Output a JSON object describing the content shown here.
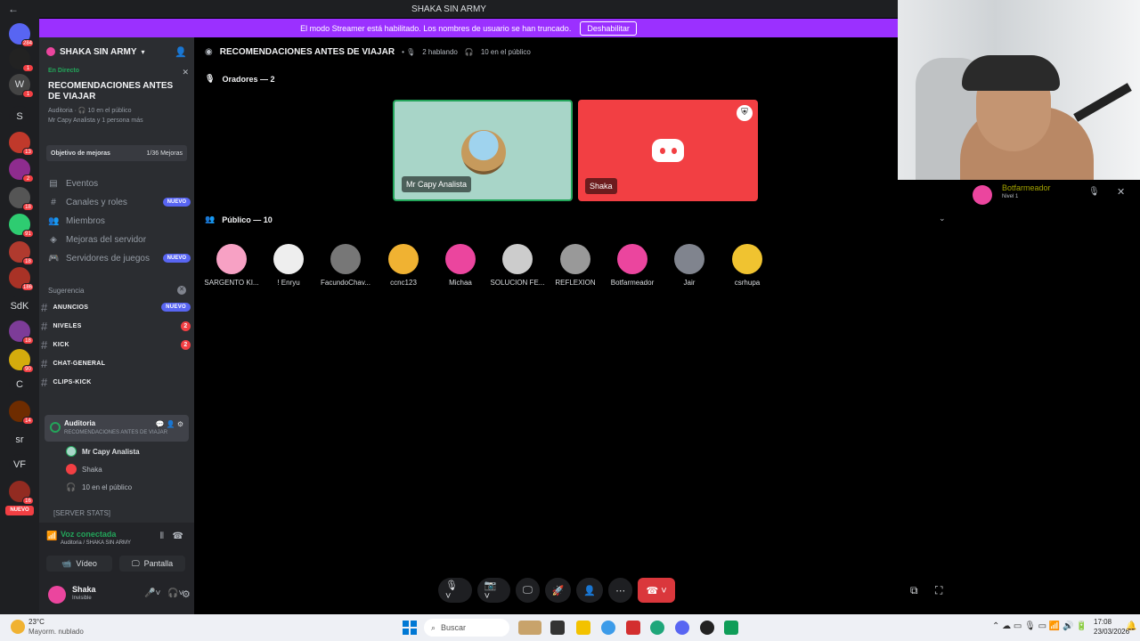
{
  "window": {
    "title": "SHAKA SIN ARMY",
    "back": "←"
  },
  "banner": {
    "text": "El modo Streamer está habilitado. Los nombres de usuario se han truncado.",
    "button": "Deshabilitar"
  },
  "rail": {
    "servers": [
      {
        "label": "",
        "badge": "284",
        "color": "#5865f2"
      },
      {
        "label": "",
        "badge": "1",
        "color": "#222"
      },
      {
        "label": "W",
        "badge": "1",
        "color": "#444"
      },
      {
        "label": "S",
        "badge": "",
        "color": "#1e1f22"
      },
      {
        "label": "",
        "badge": "13",
        "color": "#c0392b"
      },
      {
        "label": "",
        "badge": "2",
        "color": "#8e2c8e"
      },
      {
        "label": "",
        "badge": "18",
        "color": "#555"
      },
      {
        "label": "",
        "badge": "91",
        "color": "#2ecc71"
      },
      {
        "label": "",
        "badge": "18",
        "color": "#b03a2e"
      },
      {
        "label": "",
        "badge": "186",
        "color": "#a93226"
      },
      {
        "label": "SdK",
        "badge": "",
        "color": "#1e1f22"
      },
      {
        "label": "",
        "badge": "18",
        "color": "#7d3c98"
      },
      {
        "label": "",
        "badge": "90",
        "color": "#d4ac0d"
      },
      {
        "label": "C",
        "badge": "",
        "color": "#1e1f22"
      },
      {
        "label": "",
        "badge": "14",
        "color": "#6e2c00"
      },
      {
        "label": "sr",
        "badge": "",
        "color": "#1e1f22"
      },
      {
        "label": "VF",
        "badge": "",
        "color": "#1e1f22"
      },
      {
        "label": "",
        "badge": "16",
        "color": "#922b21"
      }
    ],
    "nuevo": "NUEVO"
  },
  "sidebar": {
    "server_name": "SHAKA SIN ARMY",
    "live": {
      "tag": "En Directo",
      "title": "RECOMENDACIONES ANTES DE VIAJAR",
      "meta1": "Auditoria · 🎧 10 en el público",
      "meta2": "Mr Capy Analista y 1 persona más"
    },
    "goal": {
      "label": "Objetivo de mejoras",
      "value": "1/36 Mejoras"
    },
    "nav": [
      {
        "icon": "▤",
        "label": "Eventos",
        "badge": ""
      },
      {
        "icon": "#",
        "label": "Canales y roles",
        "badge": "NUEVO"
      },
      {
        "icon": "👥",
        "label": "Miembros",
        "badge": ""
      },
      {
        "icon": "◈",
        "label": "Mejoras del servidor",
        "badge": ""
      },
      {
        "icon": "🎮",
        "label": "Servidores de juegos",
        "badge": "NUEVO"
      }
    ],
    "suggestion": "Sugerencia",
    "channels": [
      {
        "name": "ANUNCIOS",
        "badge": "NUEVO"
      },
      {
        "name": "NIVELES",
        "badge": "2"
      },
      {
        "name": "KICK",
        "badge": "2"
      },
      {
        "name": "CHAT-GENERAL",
        "badge": ""
      },
      {
        "name": "CLIPS-KICK",
        "badge": ""
      }
    ],
    "stage": {
      "name": "Auditoria",
      "topic": "RECOMENDACIONES ANTES DE VIAJAR"
    },
    "stage_members": [
      "Mr Capy Analista",
      "Shaka",
      "10 en el público"
    ],
    "server_stats": "[SERVER STATS]",
    "voice": {
      "status": "Voz conectada",
      "where": "Auditoria / SHAKA SIN ARMY",
      "video": "Vídeo",
      "screen": "Pantalla"
    },
    "user": {
      "name": "Shaka",
      "status": "Invisible"
    }
  },
  "main": {
    "channel": "RECOMENDACIONES ANTES DE VIAJAR",
    "speaking": "2 hablando",
    "audience_count": "10 en el público",
    "speakers_header": "Oradores — 2",
    "audience_header": "Público — 10",
    "speakers": [
      {
        "name": "Mr Capy Analista",
        "bg": "#a8d5c8"
      },
      {
        "name": "Shaka",
        "bg": "#f23f43"
      }
    ],
    "audience": [
      {
        "name": "SARGENTO KI...",
        "color": "#f7a1c4"
      },
      {
        "name": "! Enryu",
        "color": "#eeeeee"
      },
      {
        "name": "FacundoChav...",
        "color": "#777777"
      },
      {
        "name": "ccnc123",
        "color": "#f0b232"
      },
      {
        "name": "Michaa",
        "color": "#eb459e"
      },
      {
        "name": "SOLUCION FE...",
        "color": "#cccccc"
      },
      {
        "name": "REFLEXION",
        "color": "#999999"
      },
      {
        "name": "Botfarmeador",
        "color": "#eb459e"
      },
      {
        "name": "Jair",
        "color": "#80848e"
      },
      {
        "name": "csrhupa",
        "color": "#f0c330"
      }
    ]
  },
  "right_panel": {
    "name": "Botfarmeador",
    "level": "Nivel 1"
  },
  "taskbar": {
    "weather_temp": "23°C",
    "weather_desc": "Mayorm. nublado",
    "search": "Buscar",
    "time": "17:08",
    "date": "23/03/2026"
  }
}
